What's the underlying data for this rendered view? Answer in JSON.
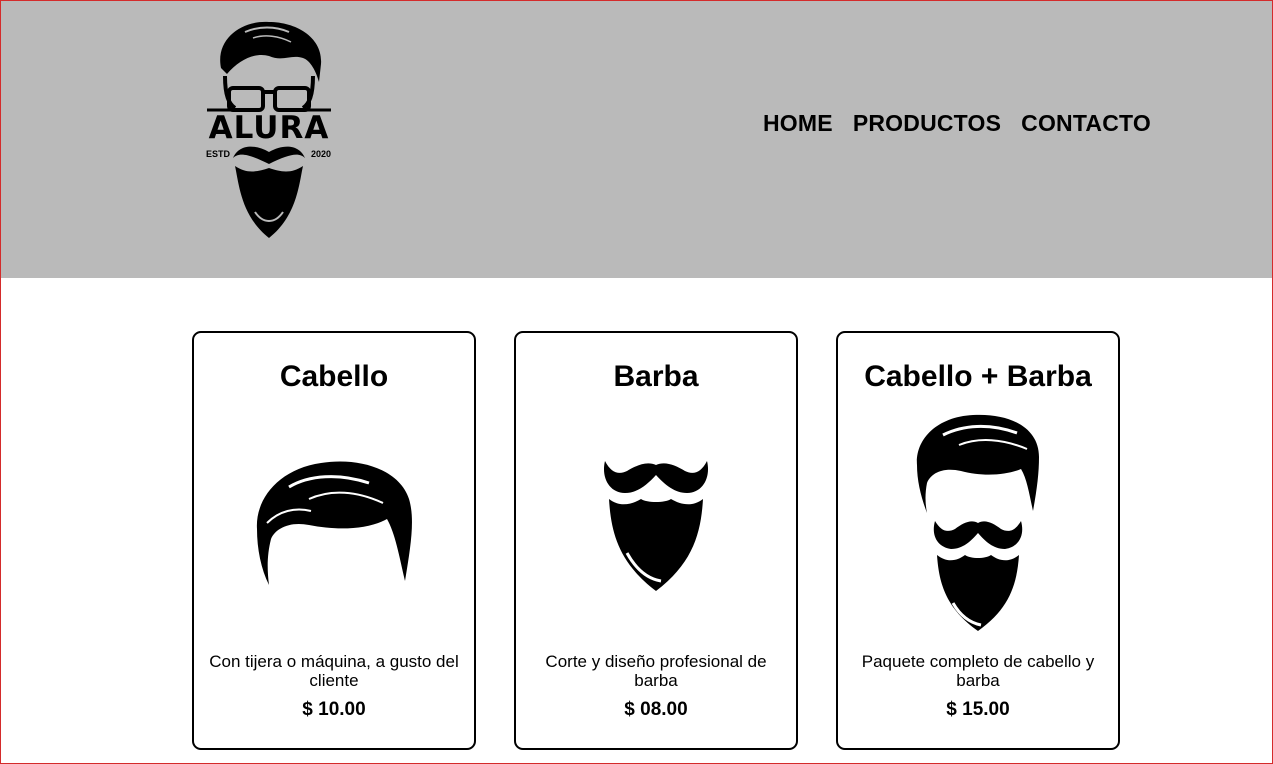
{
  "header": {
    "logo": {
      "brand": "ALURA",
      "estd_left": "ESTD",
      "estd_right": "2020"
    },
    "nav": [
      {
        "label": "HOME"
      },
      {
        "label": "PRODUCTOS"
      },
      {
        "label": "CONTACTO"
      }
    ]
  },
  "products": [
    {
      "title": "Cabello",
      "image": "hair-icon",
      "description": "Con tijera o máquina, a gusto del cliente",
      "price": "$ 10.00"
    },
    {
      "title": "Barba",
      "image": "beard-icon",
      "description": "Corte y diseño profesional de barba",
      "price": "$ 08.00"
    },
    {
      "title": "Cabello + Barba",
      "image": "hair-and-beard-icon",
      "description": "Paquete completo de cabello y barba",
      "price": "$ 15.00"
    }
  ],
  "colors": {
    "header_bg": "#bababa",
    "page_bg": "#ffffff",
    "frame_border": "#d42b2b",
    "ink": "#000000"
  }
}
